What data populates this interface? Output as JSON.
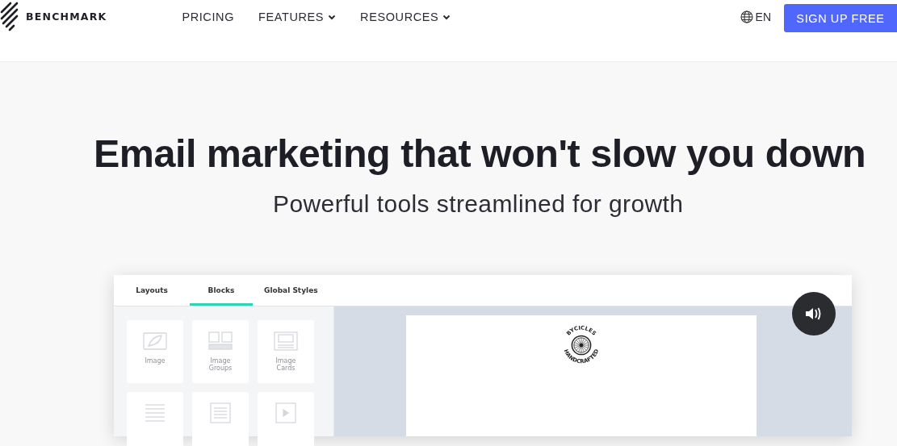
{
  "header": {
    "logo": "BENCHMARK",
    "nav": [
      {
        "label": "PRICING",
        "kind": "link"
      },
      {
        "label": "FEATURES",
        "kind": "dropdown"
      },
      {
        "label": "RESOURCES",
        "kind": "dropdown"
      }
    ],
    "language": "EN",
    "cta": "SIGN UP FREE"
  },
  "hero": {
    "title": "Email marketing that won't slow you down",
    "subtitle": "Powerful tools streamlined for growth"
  },
  "editor": {
    "tabs": [
      {
        "label": "Layouts",
        "selected": false
      },
      {
        "label": "Blocks",
        "selected": true
      },
      {
        "label": "Global Styles",
        "selected": false
      }
    ],
    "blocks": [
      {
        "kind": "image",
        "label": "Image"
      },
      {
        "kind": "image-groups",
        "label": "Image Groups"
      },
      {
        "kind": "image-cards",
        "label": "Image Cards"
      },
      {
        "kind": "text"
      },
      {
        "kind": "text-card"
      },
      {
        "kind": "video"
      }
    ],
    "email_logo": {
      "top": "BYCICLES",
      "bottom": "HANDCRAFTED"
    }
  }
}
